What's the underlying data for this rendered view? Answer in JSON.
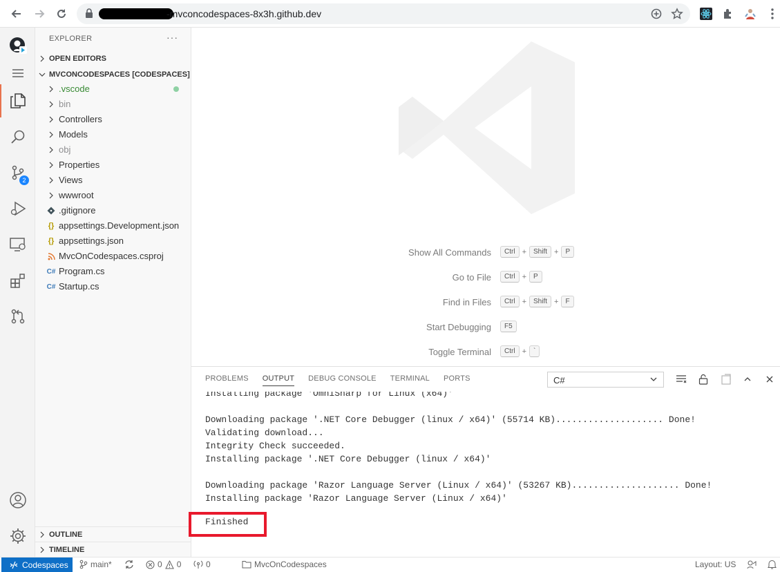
{
  "browser": {
    "url": "-mvconcodespaces-8x3h.github.dev"
  },
  "activity_bar": {
    "scm_badge": "2"
  },
  "sidebar": {
    "title": "EXPLORER",
    "more": "···",
    "open_editors": "OPEN EDITORS",
    "workspace": "MVCONCODESPACES [CODESPACES]",
    "items": [
      {
        "label": ".vscode",
        "kind": "folder",
        "color": "#388a34"
      },
      {
        "label": "bin",
        "kind": "folder",
        "color": "#8e8e90"
      },
      {
        "label": "Controllers",
        "kind": "folder",
        "color": "#333333"
      },
      {
        "label": "Models",
        "kind": "folder",
        "color": "#333333"
      },
      {
        "label": "obj",
        "kind": "folder",
        "color": "#8e8e90"
      },
      {
        "label": "Properties",
        "kind": "folder",
        "color": "#333333"
      },
      {
        "label": "Views",
        "kind": "folder",
        "color": "#333333"
      },
      {
        "label": "wwwroot",
        "kind": "folder",
        "color": "#333333"
      },
      {
        "label": ".gitignore",
        "kind": "git",
        "color": "#333333"
      },
      {
        "label": "appsettings.Development.json",
        "kind": "json",
        "color": "#333333"
      },
      {
        "label": "appsettings.json",
        "kind": "json",
        "color": "#333333"
      },
      {
        "label": "MvcOnCodespaces.csproj",
        "kind": "rss",
        "color": "#333333"
      },
      {
        "label": "Program.cs",
        "kind": "cs",
        "color": "#333333"
      },
      {
        "label": "Startup.cs",
        "kind": "cs",
        "color": "#333333"
      }
    ],
    "outline": "OUTLINE",
    "timeline": "TIMELINE"
  },
  "editor": {
    "shortcuts": [
      {
        "label": "Show All Commands",
        "keys": [
          "Ctrl",
          "Shift",
          "P"
        ]
      },
      {
        "label": "Go to File",
        "keys": [
          "Ctrl",
          "P"
        ]
      },
      {
        "label": "Find in Files",
        "keys": [
          "Ctrl",
          "Shift",
          "F"
        ]
      },
      {
        "label": "Start Debugging",
        "keys": [
          "F5"
        ]
      },
      {
        "label": "Toggle Terminal",
        "keys": [
          "Ctrl",
          "`"
        ]
      }
    ]
  },
  "panel": {
    "tabs": [
      "PROBLEMS",
      "OUTPUT",
      "DEBUG CONSOLE",
      "TERMINAL",
      "PORTS"
    ],
    "active_tab": "OUTPUT",
    "channel": "C#",
    "output_lines": [
      "Installing package 'OmniSharp for Linux (x64)'",
      "",
      "Downloading package '.NET Core Debugger (linux / x64)' (55714 KB).................... Done!",
      "Validating download...",
      "Integrity Check succeeded.",
      "Installing package '.NET Core Debugger (linux / x64)'",
      "",
      "Downloading package 'Razor Language Server (Linux / x64)' (53267 KB).................... Done!",
      "Installing package 'Razor Language Server (Linux / x64)'"
    ],
    "finished": "Finished"
  },
  "statusbar": {
    "remote": "Codespaces",
    "branch": "main*",
    "errors": "0",
    "warnings": "0",
    "ports": "0",
    "project": "MvcOnCodespaces",
    "layout": "Layout: US"
  },
  "colors": {
    "accent": "#0e6fc7",
    "highlight_box": "#e8192c",
    "active_indicator": "#e8734d"
  }
}
